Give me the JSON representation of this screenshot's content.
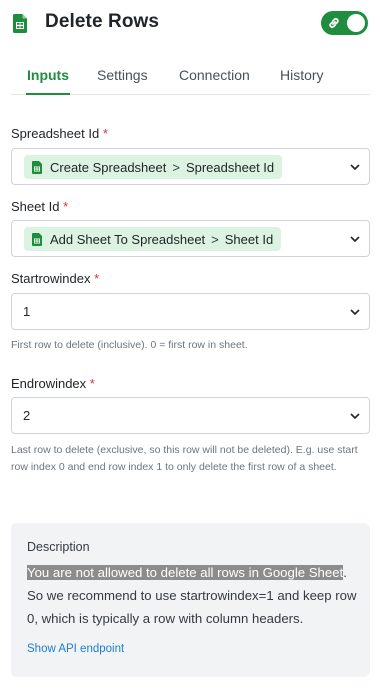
{
  "header": {
    "title": "Delete Rows",
    "icon": "google-sheets-icon",
    "toggle_icon": "link-icon",
    "toggle_on": true,
    "accent_color": "#1e8e3e"
  },
  "tabs": [
    {
      "label": "Inputs",
      "active": true
    },
    {
      "label": "Settings",
      "active": false
    },
    {
      "label": "Connection",
      "active": false
    },
    {
      "label": "History",
      "active": false
    }
  ],
  "fields": {
    "spreadsheet_id": {
      "label": "Spreadsheet Id",
      "required_mark": "*",
      "chip": {
        "source": "Create Spreadsheet",
        "separator": ">",
        "property": "Spreadsheet Id"
      }
    },
    "sheet_id": {
      "label": "Sheet Id",
      "required_mark": "*",
      "chip": {
        "source": "Add Sheet To Spreadsheet",
        "separator": ">",
        "property": "Sheet Id"
      }
    },
    "start_row_index": {
      "label": "Startrowindex",
      "required_mark": "*",
      "value": "1",
      "help": "First row to delete (inclusive). 0 = first row in sheet."
    },
    "end_row_index": {
      "label": "Endrowindex",
      "required_mark": "*",
      "value": "2",
      "help": "Last row to delete (exclusive, so this row will not be deleted). E.g. use start row index 0 and end row index 1 to only delete the first row of a sheet."
    }
  },
  "description": {
    "title": "Description",
    "highlighted": "You are not allowed to delete all rows in Google Sheet",
    "rest": ". So we recommend to use startrowindex=1 and keep row 0, which is typically a row with column headers.",
    "link": "Show API endpoint"
  }
}
